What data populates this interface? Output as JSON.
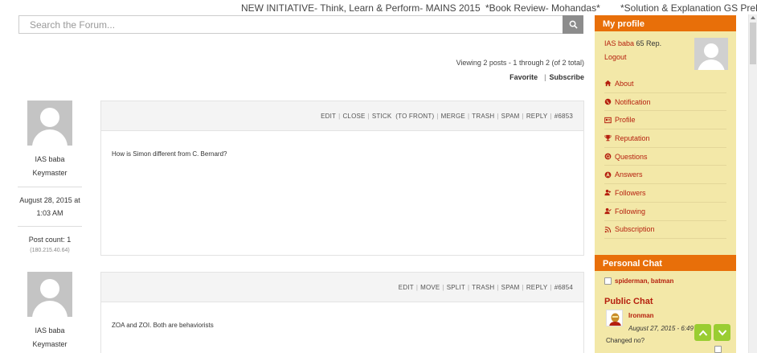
{
  "ticker": {
    "item1": "NEW INITIATIVE- Think, Learn & Perform- MAINS 2015",
    "item2": "*Book Review- Mohandas*",
    "item3": "*Solution & Explanation GS Prelims"
  },
  "search": {
    "placeholder": "Search the Forum..."
  },
  "topic": {
    "viewing": "Viewing 2 posts - 1 through 2 (of 2 total)",
    "favorite": "Favorite",
    "separator": "|",
    "subscribe": "Subscribe"
  },
  "posts": [
    {
      "author": "IAS baba",
      "role": "Keymaster",
      "date": "August 28, 2015 at",
      "time": "1:03 AM",
      "post_count": "Post count: 1",
      "ip": "(180.215.40.64)",
      "actions": [
        "EDIT",
        "CLOSE",
        "STICK",
        "(TO FRONT)",
        "MERGE",
        "TRASH",
        "SPAM",
        "REPLY",
        "#6853"
      ],
      "content": "How is Simon different from C. Bernard?"
    },
    {
      "author": "IAS baba",
      "role": "Keymaster",
      "actions": [
        "EDIT",
        "MOVE",
        "SPLIT",
        "TRASH",
        "SPAM",
        "REPLY",
        "#6854"
      ],
      "content": "ZOA and ZOI. Both are behaviorists"
    }
  ],
  "sidebar": {
    "profile_title": "My profile",
    "username": "IAS baba",
    "rep": "65 Rep.",
    "logout": "Logout",
    "menu": [
      {
        "label": "About",
        "icon": "home-icon"
      },
      {
        "label": "Notification",
        "icon": "globe-icon"
      },
      {
        "label": "Profile",
        "icon": "profile-card-icon"
      },
      {
        "label": "Reputation",
        "icon": "trophy-icon"
      },
      {
        "label": "Questions",
        "icon": "question-icon"
      },
      {
        "label": "Answers",
        "icon": "answer-icon"
      },
      {
        "label": "Followers",
        "icon": "followers-icon"
      },
      {
        "label": "Following",
        "icon": "following-icon"
      },
      {
        "label": "Subscription",
        "icon": "rss-icon"
      }
    ],
    "personal_chat_title": "Personal Chat",
    "personal_chat_users": "spiderman, batman",
    "public_chat_title": "Public Chat",
    "chat_user": "Ironman",
    "chat_time": "August 27, 2015 - 6:49",
    "chat_message": "Changed no?"
  },
  "colors": {
    "accent": "#e86f09",
    "sidebar_bg": "#f3e8a8",
    "link": "#b51f0e",
    "scroll_button": "#9acd32"
  }
}
